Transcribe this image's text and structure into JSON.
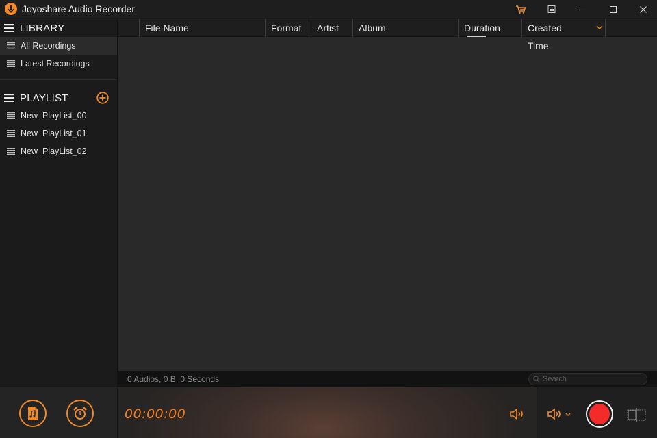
{
  "app": {
    "title": "Joyoshare Audio Recorder"
  },
  "sidebar": {
    "library_label": "LIBRARY",
    "library_items": [
      {
        "label": "All Recordings",
        "active": true
      },
      {
        "label": "Latest Recordings",
        "active": false
      }
    ],
    "playlist_label": "PLAYLIST",
    "playlist_items": [
      {
        "label": "New  PlayList_00"
      },
      {
        "label": "New  PlayList_01"
      },
      {
        "label": "New  PlayList_02"
      }
    ]
  },
  "table": {
    "columns": [
      "File Name",
      "Format",
      "Artist",
      "Album",
      "Duration",
      "Created Time"
    ],
    "sorted_by": "Created Time"
  },
  "status": {
    "summary": "0 Audios, 0 B, 0 Seconds",
    "search_placeholder": "Search"
  },
  "player": {
    "time": "00:00:00"
  },
  "colors": {
    "accent": "#ef8a2a",
    "record": "#f42b2b"
  }
}
